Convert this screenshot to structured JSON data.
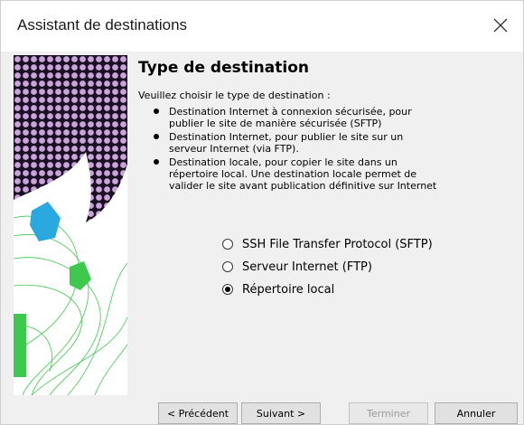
{
  "window": {
    "title": "Assistant de destinations"
  },
  "page": {
    "heading": "Type de destination",
    "intro": "Veuillez choisir le type de destination :",
    "bullets": [
      "Destination Internet à connexion sécurisée, pour\npublier le site de manière sécurisée (SFTP)",
      "Destination Internet, pour publier le site sur un\nserveur Internet (via FTP).",
      "Destination locale, pour copier le site dans un\nrépertoire local. Une destination locale permet de\nvalider le site avant publication définitive sur Internet"
    ],
    "options": [
      {
        "label": "SSH File Transfer Protocol (SFTP)",
        "selected": false
      },
      {
        "label": "Serveur Internet (FTP)",
        "selected": false
      },
      {
        "label": "Répertoire local",
        "selected": true
      }
    ]
  },
  "buttons": {
    "previous": "< Précédent",
    "next": "Suivant >",
    "finish": "Terminer",
    "cancel": "Annuler"
  },
  "colors": {
    "side_purple": "#b57ec9",
    "side_blue": "#2aa9e0",
    "side_green": "#3ec84e"
  },
  "icons": {
    "close": "close-icon"
  }
}
